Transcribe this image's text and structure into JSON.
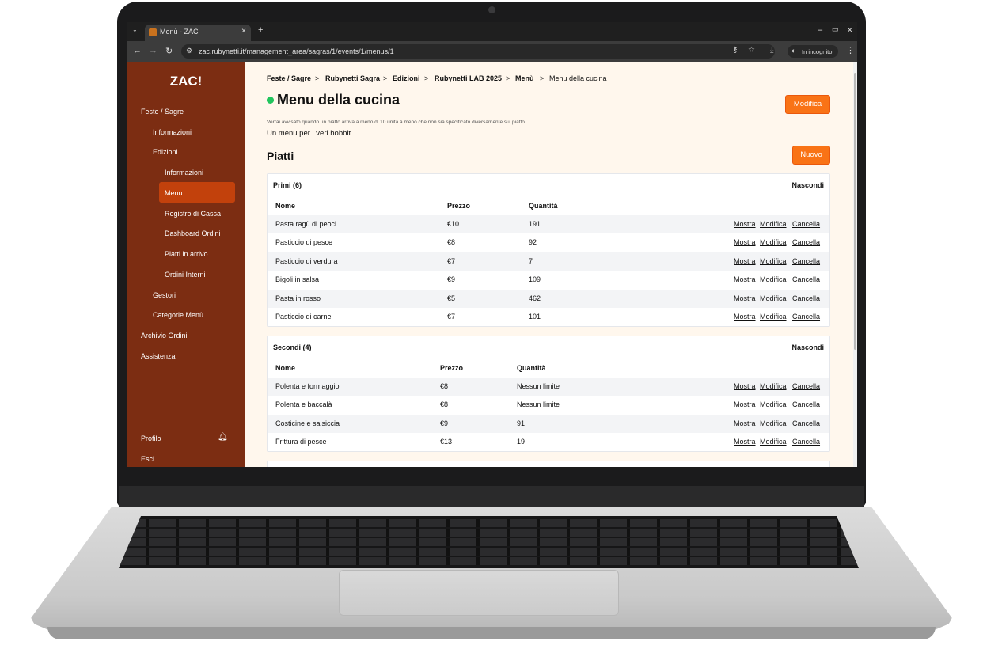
{
  "browser": {
    "tab_title": "Menù - ZAC",
    "tab_close": "×",
    "new_tab": "+",
    "url": "zac.rubynetti.it/management_area/sagras/1/events/1/menus/1",
    "incognito": "In incognito",
    "window_minimize": "–",
    "window_restore": "▭",
    "window_close": "✕"
  },
  "sidebar": {
    "logo": "ZAC!",
    "items": [
      {
        "label": "Feste / Sagre"
      },
      {
        "label": "Informazioni"
      },
      {
        "label": "Edizioni"
      },
      {
        "label": "Informazioni"
      },
      {
        "label": "Menu"
      },
      {
        "label": "Registro di Cassa"
      },
      {
        "label": "Dashboard Ordini"
      },
      {
        "label": "Piatti in arrivo"
      },
      {
        "label": "Ordini Interni"
      },
      {
        "label": "Gestori"
      },
      {
        "label": "Categorie Menù"
      },
      {
        "label": "Archivio Ordini"
      },
      {
        "label": "Assistenza"
      }
    ],
    "profile": "Profilo",
    "logout": "Esci"
  },
  "breadcrumb": {
    "items": [
      "Feste / Sagre",
      "Rubynetti Sagra",
      "Edizioni",
      "Rubynetti LAB 2025",
      "Menù",
      "Menu della cucina"
    ],
    "separator": ">"
  },
  "page": {
    "title": "Menu della cucina",
    "edit_button": "Modifica",
    "notice": "Verrai avvisato quando un piatto arriva a meno di 10 unità a meno che non sia specificato diversamente sul piatto.",
    "description": "Un menu per i veri hobbit",
    "section_title": "Piatti",
    "new_button": "Nuovo"
  },
  "categories": [
    {
      "title": "Primi (6)",
      "hide": "Nascondi",
      "headers": [
        "Nome",
        "Prezzo",
        "Quantità"
      ],
      "rows": [
        {
          "name": "Pasta ragù di peoci",
          "price": "€10",
          "qty": "191"
        },
        {
          "name": "Pasticcio di pesce",
          "price": "€8",
          "qty": "92"
        },
        {
          "name": "Pasticcio di verdura",
          "price": "€7",
          "qty": "7"
        },
        {
          "name": "Bigoli in salsa",
          "price": "€9",
          "qty": "109"
        },
        {
          "name": "Pasta in rosso",
          "price": "€5",
          "qty": "462"
        },
        {
          "name": "Pasticcio di carne",
          "price": "€7",
          "qty": "101"
        }
      ]
    },
    {
      "title": "Secondi (4)",
      "hide": "Nascondi",
      "headers": [
        "Nome",
        "Prezzo",
        "Quantità"
      ],
      "rows": [
        {
          "name": "Polenta e formaggio",
          "price": "€8",
          "qty": "Nessun limite"
        },
        {
          "name": "Polenta e baccalà",
          "price": "€8",
          "qty": "Nessun limite"
        },
        {
          "name": "Costicine e salsiccia",
          "price": "€9",
          "qty": "91"
        },
        {
          "name": "Frittura di pesce",
          "price": "€13",
          "qty": "19"
        }
      ]
    }
  ],
  "row_actions": {
    "show": "Mostra",
    "edit": "Modifica",
    "delete": "Cancella"
  },
  "colors": {
    "sidebar": "#7c2d12",
    "active": "#c2410c",
    "accent": "#f97316",
    "content_bg": "#fff7ed",
    "status": "#22c55e"
  }
}
